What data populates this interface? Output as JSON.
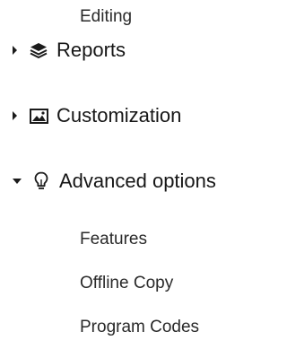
{
  "nav": {
    "top_child": "Editing",
    "sections": [
      {
        "label": "Reports",
        "icon": "layers-icon",
        "state": "collapsed"
      },
      {
        "label": "Customization",
        "icon": "image-icon",
        "state": "collapsed"
      },
      {
        "label": "Advanced options",
        "icon": "lightbulb-icon",
        "state": "expanded"
      }
    ],
    "advanced_children": [
      {
        "label": "Features"
      },
      {
        "label": "Offline Copy"
      },
      {
        "label": "Program Codes"
      }
    ]
  },
  "colors": {
    "text": "#1b1b1b",
    "subtext": "#2a2a2a",
    "background": "#ffffff"
  }
}
